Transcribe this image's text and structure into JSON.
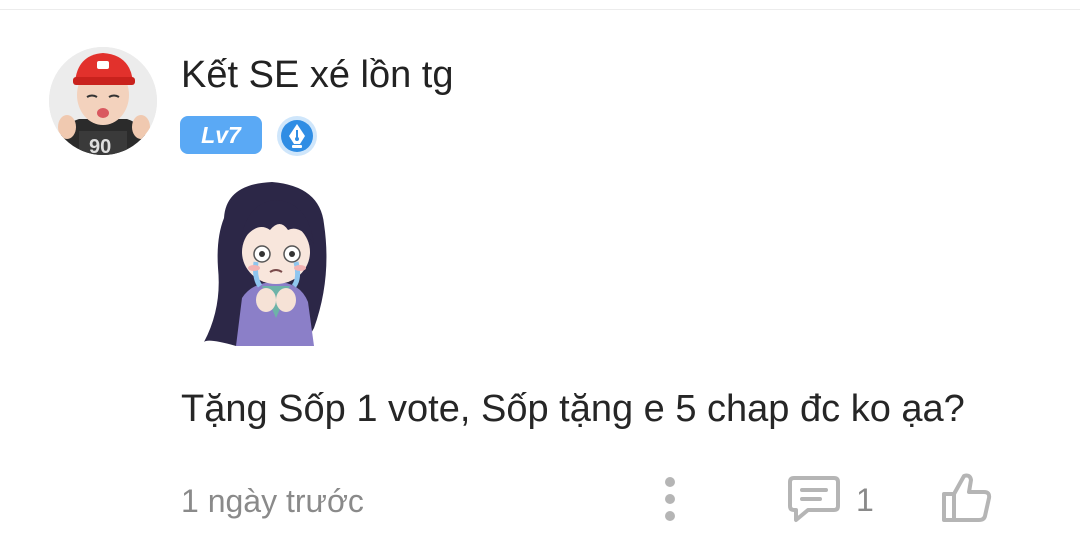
{
  "comment": {
    "username": "Kết SE xé lồn tg",
    "level_badge": "Lv7",
    "author_badge_icon": "pen-nib-icon",
    "sticker_icon": "crying-anime-girl-sticker",
    "text": "Tặng Sốp 1 vote, Sốp tặng e 5 chap đc ko ạa?",
    "timestamp": "1 ngày trước",
    "reply_count": "1"
  },
  "actions": {
    "more_icon": "more-vertical-icon",
    "reply_icon": "comment-icon",
    "like_icon": "thumbs-up-icon"
  },
  "colors": {
    "level_badge_bg": "#5aa9f5",
    "author_badge": "#2f8de4",
    "muted_text": "#8a8a8a",
    "icon_gray": "#b5b5b5"
  }
}
